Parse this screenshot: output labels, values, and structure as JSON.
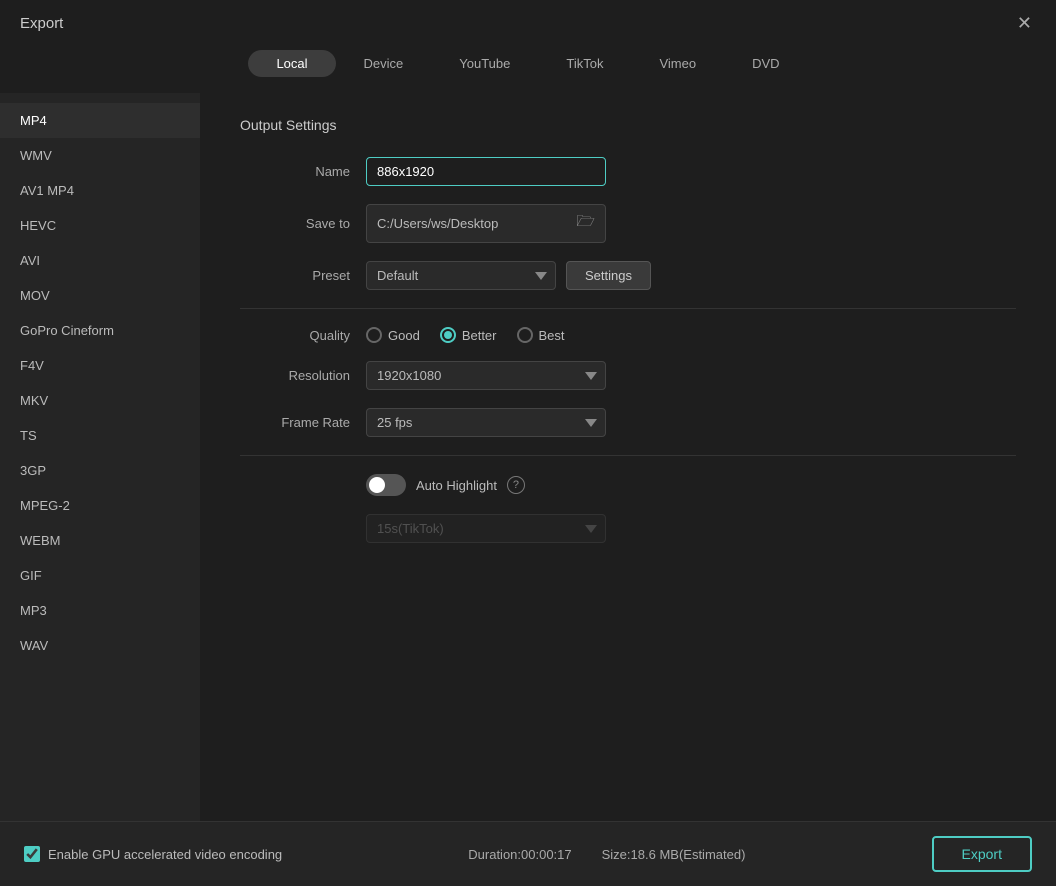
{
  "titleBar": {
    "title": "Export"
  },
  "tabs": [
    {
      "id": "local",
      "label": "Local",
      "active": true
    },
    {
      "id": "device",
      "label": "Device",
      "active": false
    },
    {
      "id": "youtube",
      "label": "YouTube",
      "active": false
    },
    {
      "id": "tiktok",
      "label": "TikTok",
      "active": false
    },
    {
      "id": "vimeo",
      "label": "Vimeo",
      "active": false
    },
    {
      "id": "dvd",
      "label": "DVD",
      "active": false
    }
  ],
  "sidebar": {
    "items": [
      {
        "id": "mp4",
        "label": "MP4",
        "active": true
      },
      {
        "id": "wmv",
        "label": "WMV",
        "active": false
      },
      {
        "id": "av1mp4",
        "label": "AV1 MP4",
        "active": false
      },
      {
        "id": "hevc",
        "label": "HEVC",
        "active": false
      },
      {
        "id": "avi",
        "label": "AVI",
        "active": false
      },
      {
        "id": "mov",
        "label": "MOV",
        "active": false
      },
      {
        "id": "gopro",
        "label": "GoPro Cineform",
        "active": false
      },
      {
        "id": "f4v",
        "label": "F4V",
        "active": false
      },
      {
        "id": "mkv",
        "label": "MKV",
        "active": false
      },
      {
        "id": "ts",
        "label": "TS",
        "active": false
      },
      {
        "id": "3gp",
        "label": "3GP",
        "active": false
      },
      {
        "id": "mpeg2",
        "label": "MPEG-2",
        "active": false
      },
      {
        "id": "webm",
        "label": "WEBM",
        "active": false
      },
      {
        "id": "gif",
        "label": "GIF",
        "active": false
      },
      {
        "id": "mp3",
        "label": "MP3",
        "active": false
      },
      {
        "id": "wav",
        "label": "WAV",
        "active": false
      }
    ]
  },
  "outputSettings": {
    "title": "Output Settings",
    "nameLabel": "Name",
    "nameValue": "886x1920",
    "saveToLabel": "Save to",
    "saveToPath": "C:/Users/ws/Desktop",
    "presetLabel": "Preset",
    "presetValue": "Default",
    "settingsButtonLabel": "Settings",
    "qualityLabel": "Quality",
    "qualityOptions": [
      {
        "id": "good",
        "label": "Good",
        "checked": false
      },
      {
        "id": "better",
        "label": "Better",
        "checked": true
      },
      {
        "id": "best",
        "label": "Best",
        "checked": false
      }
    ],
    "resolutionLabel": "Resolution",
    "resolutionValue": "1920x1080",
    "frameRateLabel": "Frame Rate",
    "frameRateValue": "25 fps",
    "autoHighlightLabel": "Auto Highlight",
    "autoHighlightOn": false,
    "tiktokDropdownValue": "15s(TikTok)"
  },
  "bottomBar": {
    "gpuCheckboxLabel": "Enable GPU accelerated video encoding",
    "gpuChecked": true,
    "duration": "Duration:00:00:17",
    "size": "Size:18.6 MB(Estimated)",
    "exportLabel": "Export"
  }
}
